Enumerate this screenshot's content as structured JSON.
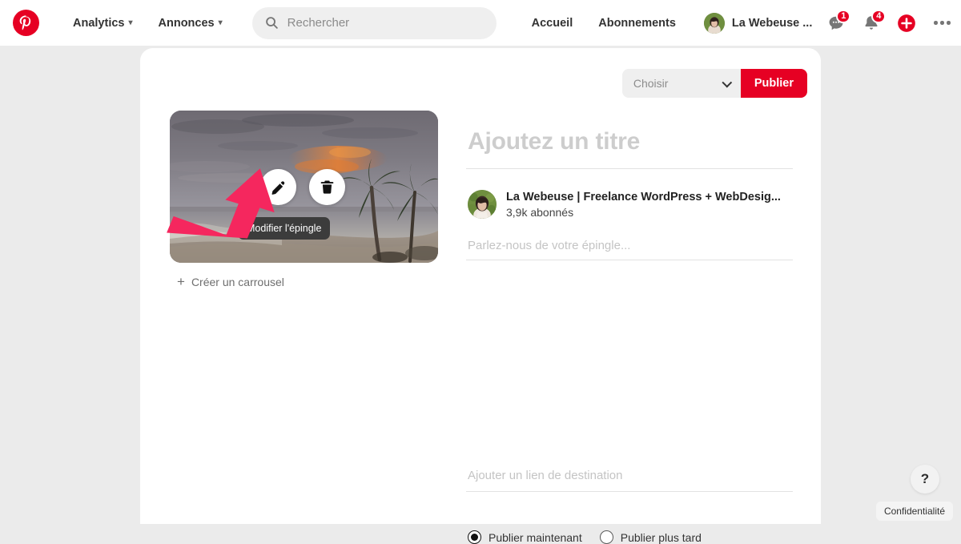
{
  "header": {
    "logo_icon": "pinterest-logo-icon",
    "menus": [
      {
        "label": "Analytics",
        "caret": "∨"
      },
      {
        "label": "Annonces",
        "caret": "∨"
      }
    ],
    "search": {
      "icon": "search-icon",
      "placeholder": "Rechercher",
      "value": ""
    },
    "links": [
      {
        "label": "Accueil"
      },
      {
        "label": "Abonnements"
      }
    ],
    "account": {
      "name": "La Webeuse ...",
      "avatar": "user-avatar"
    },
    "icons": [
      {
        "name": "messages-icon",
        "badge": "1"
      },
      {
        "name": "notifications-icon",
        "badge": "4"
      },
      {
        "name": "create-pin-icon",
        "badge": ""
      },
      {
        "name": "more-options-icon",
        "badge": ""
      }
    ]
  },
  "composer": {
    "board_select": {
      "placeholder": "Choisir",
      "value": "Choisir",
      "chevron_icon": "chevron-down-icon"
    },
    "publish_button": "Publier",
    "image": {
      "alt": "Plage tropicale au coucher du soleil avec palmiers",
      "edit_button_icon": "pencil-icon",
      "delete_button_icon": "trash-icon",
      "tooltip": "Modifier l'épingle",
      "annotation": "pink-arrow-pointing-to-edit-button"
    },
    "carousel_link": {
      "icon": "plus-icon",
      "label": "Créer un carrousel"
    },
    "title_field": {
      "placeholder": "Ajoutez un titre",
      "value": ""
    },
    "author": {
      "avatar": "author-avatar",
      "name": "La Webeuse | Freelance WordPress + WebDesig...",
      "followers": "3,9k abonnés"
    },
    "description_field": {
      "placeholder": "Parlez-nous de votre épingle...",
      "value": ""
    },
    "link_field": {
      "placeholder": "Ajouter un lien de destination",
      "value": ""
    },
    "schedule": {
      "options": [
        {
          "label": "Publier maintenant",
          "checked": true
        },
        {
          "label": "Publier plus tard",
          "checked": false
        }
      ]
    }
  },
  "overlay": {
    "help_button": "?",
    "help_icon": "question-mark-icon",
    "privacy_label": "Confidentialité"
  },
  "colors": {
    "brand_red": "#e60023",
    "annotation_pink": "#f5275e",
    "page_bg": "#ebebeb",
    "card_bg": "#ffffff",
    "field_gray": "#efefef"
  }
}
